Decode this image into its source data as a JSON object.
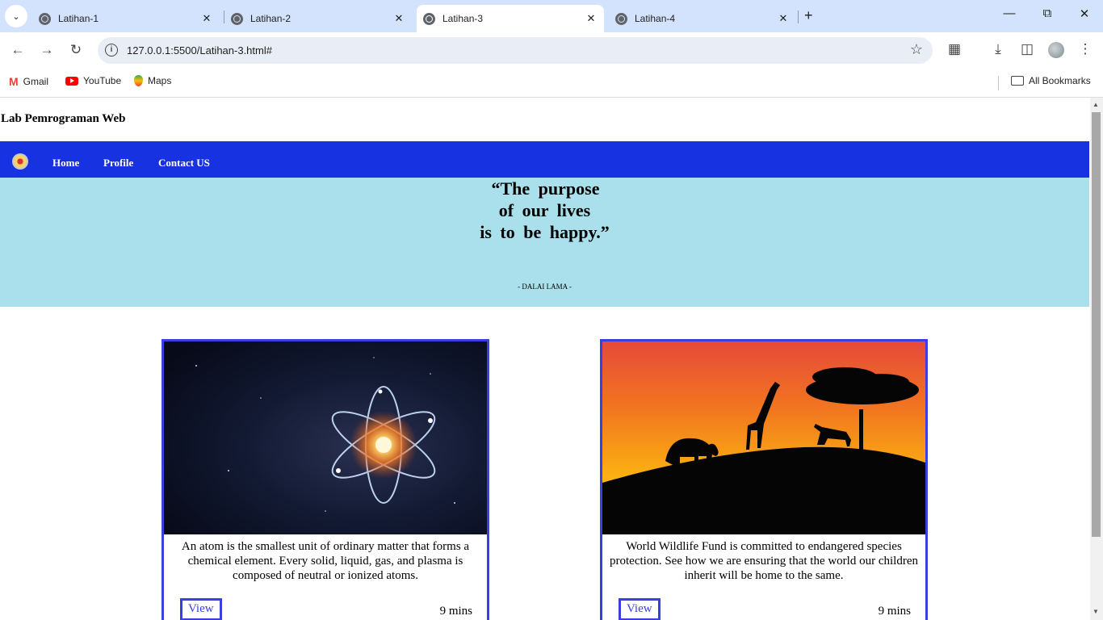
{
  "browser": {
    "tabs": [
      {
        "title": "Latihan-1",
        "active": false
      },
      {
        "title": "Latihan-2",
        "active": false
      },
      {
        "title": "Latihan-3",
        "active": true
      },
      {
        "title": "Latihan-4",
        "active": false
      }
    ],
    "url": "127.0.0.1:5500/Latihan-3.html#",
    "bookmarks": [
      {
        "label": "Gmail",
        "icon": "gmail-icon"
      },
      {
        "label": "YouTube",
        "icon": "youtube-icon"
      },
      {
        "label": "Maps",
        "icon": "maps-icon"
      }
    ],
    "all_bookmarks": "All Bookmarks"
  },
  "site": {
    "title": "Lab Pemrograman Web",
    "nav": [
      "Home",
      "Profile",
      "Contact US"
    ],
    "brand_color": "#1732e0",
    "hero_color": "#a9e0ec"
  },
  "hero": {
    "quote_lines": [
      "“The  purpose",
      "of  our  lives",
      "is  to  be  happy.”"
    ],
    "author": "- DALAI LAMA -"
  },
  "cards": [
    {
      "image": "atom-illustration",
      "description": "An atom is the smallest unit of ordinary matter that forms a chemical element. Every solid, liquid, gas, and plasma is composed of neutral or ionized atoms.",
      "button": "View",
      "duration": "9 mins"
    },
    {
      "image": "savanna-sunset-illustration",
      "description": "World Wildlife Fund is committed to endangered species protection. See how we are ensuring that the world our children inherit will be home to the same.",
      "button": "View",
      "duration": "9 mins"
    }
  ]
}
